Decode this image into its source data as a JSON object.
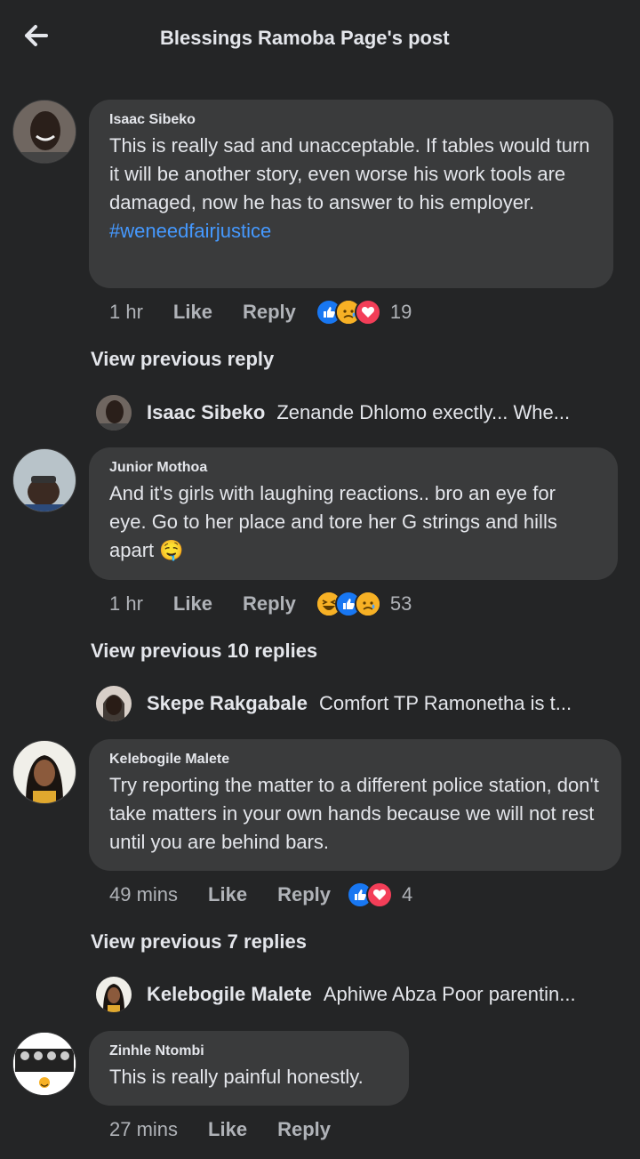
{
  "header": {
    "title": "Blessings Ramoba Page's post",
    "back_icon": "arrow-left-icon"
  },
  "colors": {
    "background": "#242526",
    "bubble": "#3a3b3c",
    "hashtag": "#4599ff",
    "like": "#1877f2",
    "love": "#f33e58"
  },
  "comments": [
    {
      "author": "Isaac Sibeko",
      "text": "This is really sad and unacceptable. If tables would turn it will be another story, even worse his work tools are damaged, now he has to answer to his employer.",
      "hashtag": "#weneedfairjustice",
      "time": "1 hr",
      "like": "Like",
      "reply": "Reply",
      "reactions": [
        "like",
        "sad",
        "love"
      ],
      "reaction_count": "19"
    },
    {
      "author": "Junior Mothoa",
      "text": "And it's girls with laughing reactions.. bro an eye for eye. Go to her place and tore her G strings and hills apart",
      "emoji": "🤤",
      "time": "1 hr",
      "like": "Like",
      "reply": "Reply",
      "reactions": [
        "haha",
        "like",
        "sad"
      ],
      "reaction_count": "53"
    },
    {
      "author": "Kelebogile Malete",
      "text": "Try reporting the matter to a different police station, don't take matters in your own hands because we will not rest until you are behind bars.",
      "time": "49 mins",
      "like": "Like",
      "reply": "Reply",
      "reactions": [
        "like",
        "love"
      ],
      "reaction_count": "4"
    },
    {
      "author": "Zinhle Ntombi",
      "text": "This is really painful honestly.",
      "time": "27 mins",
      "like": "Like",
      "reply": "Reply"
    }
  ],
  "threads": [
    {
      "view_label": "View previous reply",
      "preview_name": "Isaac Sibeko",
      "preview_text": "Zenande Dhlomo exectly... Whe..."
    },
    {
      "view_label": "View previous 10 replies",
      "preview_name": "Skepe Rakgabale",
      "preview_text": "Comfort TP Ramonetha is t..."
    },
    {
      "view_label": "View previous 7 replies",
      "preview_name": "Kelebogile Malete",
      "preview_text": "Aphiwe Abza Poor parentin..."
    }
  ]
}
